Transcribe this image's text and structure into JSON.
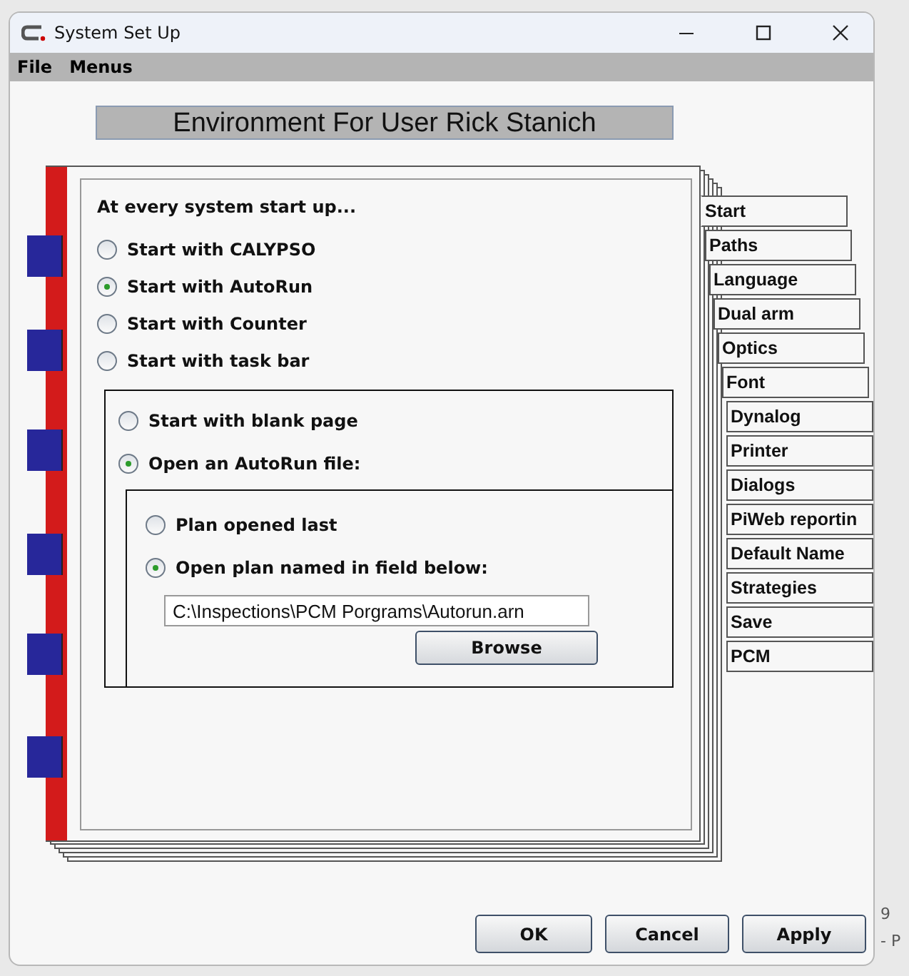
{
  "window": {
    "title": "System Set Up"
  },
  "menu_bar": [
    "File",
    "Menus"
  ],
  "header": "Environment For User Rick Stanich",
  "startup": {
    "heading": "At every system start up...",
    "options": [
      {
        "label": "Start with CALYPSO",
        "selected": false
      },
      {
        "label": "Start with AutoRun",
        "selected": true
      },
      {
        "label": "Start with Counter",
        "selected": false
      },
      {
        "label": "Start with task bar",
        "selected": false
      }
    ]
  },
  "autorun": {
    "options": [
      {
        "label": "Start with blank page",
        "selected": false
      },
      {
        "label": "Open an AutoRun file:",
        "selected": true
      }
    ]
  },
  "autorun_file": {
    "options": [
      {
        "label": "Plan opened last",
        "selected": false
      },
      {
        "label": "Open plan named in field below:",
        "selected": true
      }
    ],
    "path_field": {
      "value": "C:\\Inspections\\PCM Porgrams\\Autorun.arn"
    },
    "browse_button": "Browse"
  },
  "tabs": [
    {
      "label": "Start",
      "selected": true
    },
    {
      "label": "Paths",
      "selected": false
    },
    {
      "label": "Language",
      "selected": false
    },
    {
      "label": "Dual arm",
      "selected": false
    },
    {
      "label": "Optics",
      "selected": false
    },
    {
      "label": "Font",
      "selected": false
    },
    {
      "label": "Dynalog",
      "selected": false
    },
    {
      "label": "Printer",
      "selected": false
    },
    {
      "label": "Dialogs",
      "selected": false
    },
    {
      "label": "PiWeb reportin",
      "selected": false
    },
    {
      "label": "Default Name",
      "selected": false
    },
    {
      "label": "Strategies",
      "selected": false
    },
    {
      "label": "Save",
      "selected": false
    },
    {
      "label": "PCM",
      "selected": false
    }
  ],
  "buttons": [
    "OK",
    "Cancel",
    "Apply"
  ],
  "background_window_texts": [
    "9",
    "- P"
  ]
}
